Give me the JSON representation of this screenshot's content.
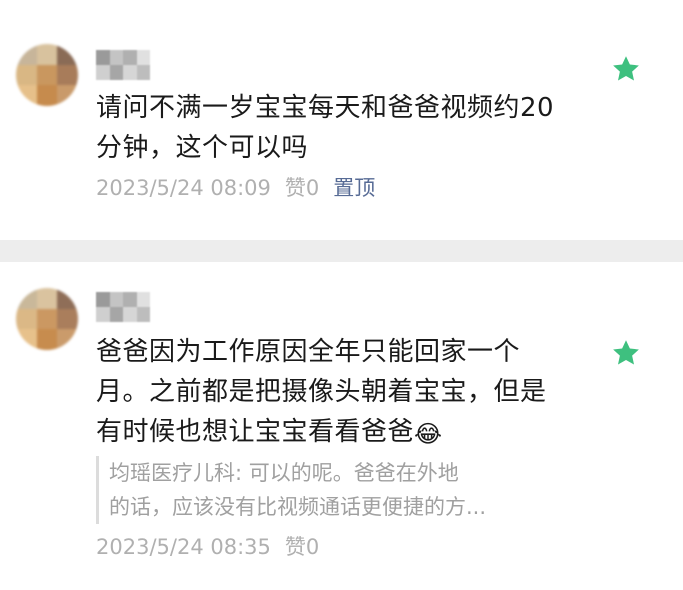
{
  "comments": [
    {
      "text": "请问不满一岁宝宝每天和爸爸视频约20分钟，这个可以吗",
      "time": "2023/5/24 08:09",
      "likes": "赞0",
      "pinned_label": "置顶",
      "starred": true
    },
    {
      "text": "爸爸因为工作原因全年只能回家一个月。之前都是把摄像头朝着宝宝，但是有时候也想让宝宝看看爸爸",
      "emoji": "😂",
      "reply": {
        "line1": "均瑶医疗儿科: 可以的呢。爸爸在外地",
        "line2": "的话，应该没有比视频通话更便捷的方..."
      },
      "time": "2023/5/24 08:35",
      "likes": "赞0",
      "starred": true
    }
  ],
  "colors": {
    "star": "#3ec07f",
    "pin_link": "#576b95",
    "separator": "#ededed"
  }
}
